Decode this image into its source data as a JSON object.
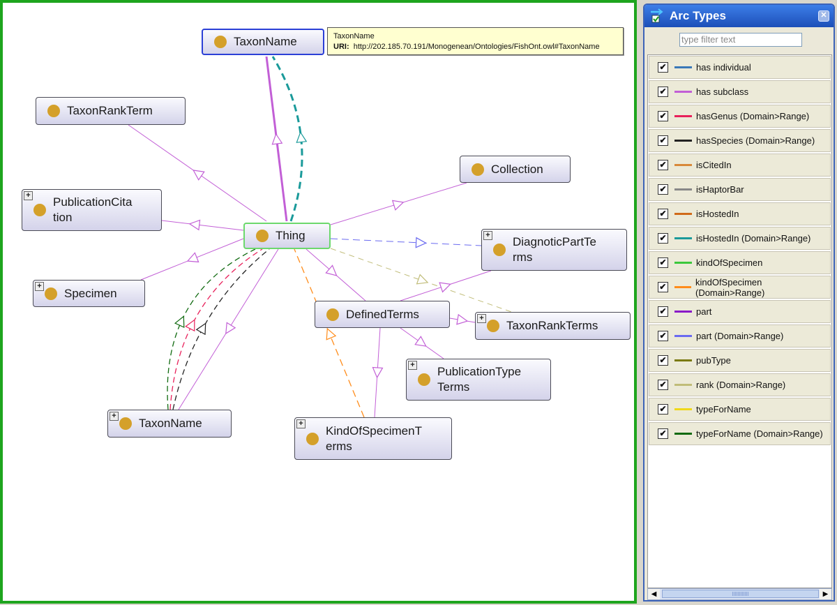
{
  "graph": {
    "nodes": [
      {
        "id": "taxonname_top",
        "label": "TaxonName",
        "state": "selected",
        "expandable": false
      },
      {
        "id": "taxonrankterm",
        "label": "TaxonRankTerm",
        "state": "normal",
        "expandable": false
      },
      {
        "id": "publicationcitation",
        "label": "PublicationCitation",
        "state": "normal",
        "expandable": true
      },
      {
        "id": "specimen",
        "label": "Specimen",
        "state": "normal",
        "expandable": true
      },
      {
        "id": "thing",
        "label": "Thing",
        "state": "focus",
        "expandable": false
      },
      {
        "id": "collection",
        "label": "Collection",
        "state": "normal",
        "expandable": false
      },
      {
        "id": "diagnosticpartterms",
        "label": "DiagnoticPartTerms",
        "state": "normal",
        "expandable": true
      },
      {
        "id": "definedterms",
        "label": "DefinedTerms",
        "state": "normal",
        "expandable": false
      },
      {
        "id": "taxonrankterms",
        "label": "TaxonRankTerms",
        "state": "normal",
        "expandable": true
      },
      {
        "id": "publicationtypeterms",
        "label": "PublicationTypeTerms",
        "state": "normal",
        "expandable": true
      },
      {
        "id": "taxonname_bottom",
        "label": "TaxonName",
        "state": "normal",
        "expandable": true
      },
      {
        "id": "kindofspecimenterms",
        "label": "KindOfSpecimenTerms",
        "state": "normal",
        "expandable": true
      }
    ],
    "node_labels": {
      "taxonname_top": [
        "TaxonName"
      ],
      "taxonrankterm": [
        "TaxonRankTerm"
      ],
      "publicationcitation": [
        "PublicationCita",
        "tion"
      ],
      "specimen": [
        "Specimen"
      ],
      "thing": [
        "Thing"
      ],
      "collection": [
        "Collection"
      ],
      "diagnosticpartterms": [
        "DiagnoticPartTe",
        "rms"
      ],
      "definedterms": [
        "DefinedTerms"
      ],
      "taxonrankterms": [
        "TaxonRankTerms"
      ],
      "publicationtypeterms": [
        "PublicationType",
        "Terms"
      ],
      "taxonname_bottom": [
        "TaxonName"
      ],
      "kindofspecimenterms": [
        "KindOfSpecimenT",
        "erms"
      ]
    },
    "edges": [
      {
        "from": "thing",
        "to": "taxonname_top",
        "type": "has subclass"
      },
      {
        "from": "thing",
        "to": "taxonname_top",
        "type": "isHostedIn (Domain>Range)"
      },
      {
        "from": "thing",
        "to": "taxonrankterm",
        "type": "has subclass"
      },
      {
        "from": "thing",
        "to": "publicationcitation",
        "type": "has subclass"
      },
      {
        "from": "thing",
        "to": "specimen",
        "type": "has subclass"
      },
      {
        "from": "thing",
        "to": "collection",
        "type": "has subclass"
      },
      {
        "from": "thing",
        "to": "diagnosticpartterms",
        "type": "part (Domain>Range)"
      },
      {
        "from": "thing",
        "to": "taxonrankterms",
        "type": "rank (Domain>Range)"
      },
      {
        "from": "thing",
        "to": "definedterms",
        "type": "has subclass"
      },
      {
        "from": "thing",
        "to": "taxonname_bottom",
        "type": "has subclass"
      },
      {
        "from": "taxonname_bottom",
        "to": "thing",
        "type": "typeForName (Domain>Range)"
      },
      {
        "from": "taxonname_bottom",
        "to": "thing",
        "type": "hasGenus (Domain>Range)"
      },
      {
        "from": "taxonname_bottom",
        "to": "thing",
        "type": "hasSpecies (Domain>Range)"
      },
      {
        "from": "kindofspecimenterms",
        "to": "thing",
        "type": "kindOfSpecimen (Domain>Range)"
      },
      {
        "from": "definedterms",
        "to": "diagnosticpartterms",
        "type": "has subclass"
      },
      {
        "from": "definedterms",
        "to": "taxonrankterms",
        "type": "has subclass"
      },
      {
        "from": "definedterms",
        "to": "publicationtypeterms",
        "type": "has subclass"
      },
      {
        "from": "definedterms",
        "to": "kindofspecimenterms",
        "type": "has subclass"
      }
    ],
    "tooltip": {
      "title": "TaxonName",
      "uri_label": "URI:",
      "uri": "http://202.185.70.191/Monogenean/Ontologies/FishOnt.owl#TaxonName"
    }
  },
  "panel": {
    "title": "Arc Types",
    "filter_placeholder": "type filter text",
    "arc_types": [
      {
        "label": "has individual",
        "color": "#3a78b8",
        "checked": true
      },
      {
        "label": "has subclass",
        "color": "#c25fd6",
        "checked": true
      },
      {
        "label": "hasGenus (Domain>Range)",
        "color": "#e8205a",
        "checked": true
      },
      {
        "label": "hasSpecies (Domain>Range)",
        "color": "#222222",
        "checked": true
      },
      {
        "label": "isCitedIn",
        "color": "#d8893a",
        "checked": true
      },
      {
        "label": "isHaptorBar",
        "color": "#888888",
        "checked": true
      },
      {
        "label": "isHostedIn",
        "color": "#d06a1a",
        "checked": true
      },
      {
        "label": "isHostedIn (Domain>Range)",
        "color": "#1a9a9a",
        "checked": true
      },
      {
        "label": "kindOfSpecimen",
        "color": "#3cc83c",
        "checked": true
      },
      {
        "label": "kindOfSpecimen (Domain>Range)",
        "color": "#ff8c1a",
        "checked": true
      },
      {
        "label": "part",
        "color": "#8a1ac8",
        "checked": true
      },
      {
        "label": "part (Domain>Range)",
        "color": "#6a6af0",
        "checked": true
      },
      {
        "label": "pubType",
        "color": "#7a7a10",
        "checked": true
      },
      {
        "label": "rank (Domain>Range)",
        "color": "#c0bc78",
        "checked": true
      },
      {
        "label": "typeForName",
        "color": "#f0d81a",
        "checked": true
      },
      {
        "label": "typeForName (Domain>Range)",
        "color": "#106a10",
        "checked": true
      }
    ]
  },
  "colors": {
    "graph_border": "#1ea51e",
    "node_dot": "#d4a02a",
    "selected_border": "#2b3fd6",
    "focus_border": "#6cd86c"
  }
}
